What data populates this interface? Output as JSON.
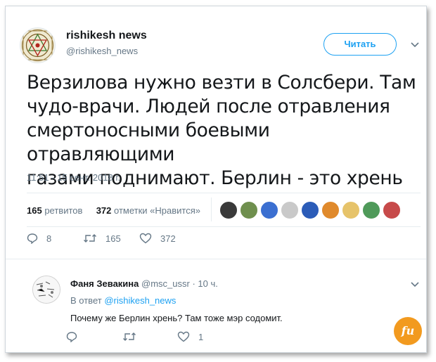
{
  "author": {
    "name": "rishikesh news",
    "handle": "@rishikesh_news"
  },
  "follow_label": "Читать",
  "tweet": {
    "lines": [
      "Верзилова нужно везти в Солсбери. Там",
      "чудо-врачи. Людей после отравления",
      "смертоносными боевыми отравляющими",
      "газами поднимают. Берлин - это хрень"
    ],
    "time": "11:51 - 15 сент. 2018 г."
  },
  "stats": {
    "retweets_count": "165",
    "retweets_label": "ретвитов",
    "likes_count": "372",
    "likes_label": "отметки «Нравится»"
  },
  "actions": {
    "replies": "8",
    "retweets": "165",
    "likes": "372"
  },
  "reply": {
    "name": "Фаня Зевакина",
    "handle": "@msc_ussr",
    "time": "· 10 ч.",
    "reply_to_prefix": "В ответ",
    "reply_to_handle": "@rishikesh_news",
    "text": "Почему же Берлин хрень? Там тоже мэр содомит.",
    "likes": "1"
  },
  "colors": {
    "accent": "#1da1f2",
    "secondary_text": "#657786",
    "primary_text": "#14171a"
  }
}
